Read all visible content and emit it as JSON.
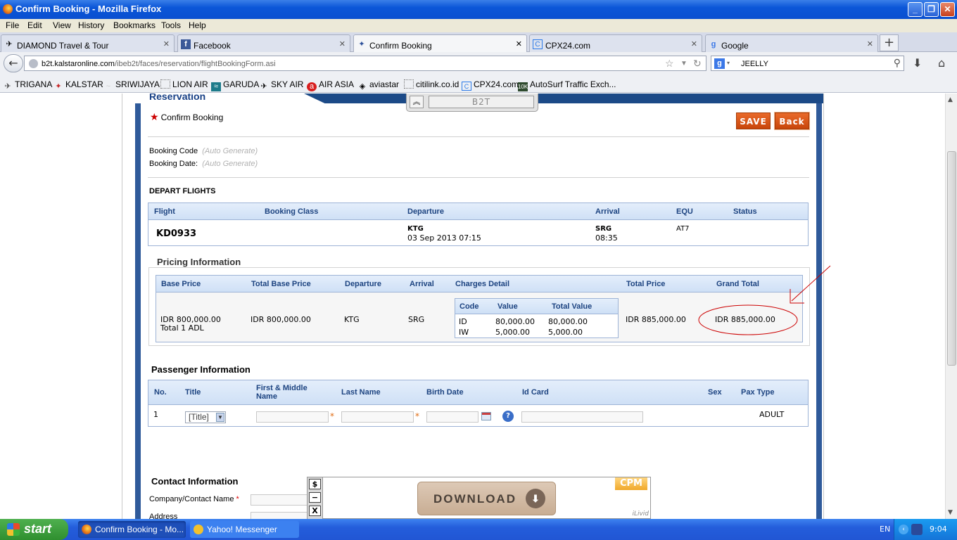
{
  "window": {
    "title": "Confirm Booking - Mozilla Firefox"
  },
  "menu": [
    "File",
    "Edit",
    "View",
    "History",
    "Bookmarks",
    "Tools",
    "Help"
  ],
  "tabs": [
    {
      "label": "DIAMOND Travel & Tour",
      "icon": "airplane-icon"
    },
    {
      "label": "Facebook",
      "icon": "facebook-icon"
    },
    {
      "label": "Confirm Booking",
      "icon": "kalstar-icon"
    },
    {
      "label": "CPX24.com",
      "icon": "cpx-icon"
    },
    {
      "label": "Google",
      "icon": "google-icon"
    }
  ],
  "nav": {
    "url_host": "b2t.kalstaronline.com",
    "url_path": "/ibeb2t/faces/reservation/flightBookingForm.asi",
    "search_value": "JEELLY"
  },
  "bookmarks": [
    "TRIGANA",
    "KALSTAR",
    "SRIWIJAYA",
    "LION AIR",
    "GARUDA",
    "SKY AIR",
    "AIR ASIA",
    "aviastar",
    "citilink.co.id",
    "CPX24.com",
    "AutoSurf Traffic Exch..."
  ],
  "page": {
    "section_title": "Reservation",
    "b2t_label": "B2T",
    "confirm_title": "Confirm Booking",
    "save_label": "SAVE",
    "back_label": "Back",
    "booking_code_label": "Booking Code",
    "booking_code_value": "(Auto Generate)",
    "booking_date_label": "Booking Date:",
    "booking_date_value": "(Auto Generate)",
    "depart_title": "DEPART FLIGHTS",
    "flight_headers": [
      "Flight",
      "Booking Class",
      "Departure",
      "Arrival",
      "EQU",
      "Status"
    ],
    "flight": {
      "number": "KD0933",
      "dep_code": "KTG",
      "dep_time": "03 Sep 2013 07:15",
      "arr_code": "SRG",
      "arr_time": "08:35",
      "equ": "AT7"
    },
    "pricing_title": "Pricing Information",
    "pricing_headers": [
      "Base Price",
      "Total Base Price",
      "Departure",
      "Arrival",
      "Charges Detail",
      "Total Price",
      "Grand Total"
    ],
    "pricing": {
      "base_price": "IDR 800,000.00",
      "pax_total": "Total 1 ADL",
      "total_base": "IDR 800,000.00",
      "departure": "KTG",
      "arrival": "SRG",
      "total_price": "IDR 885,000.00",
      "grand_total": "IDR 885,000.00"
    },
    "charges_headers": [
      "Code",
      "Value",
      "Total Value"
    ],
    "charges": [
      {
        "code": "ID",
        "value": "80,000.00",
        "total": "80,000.00"
      },
      {
        "code": "IW",
        "value": "5,000.00",
        "total": "5,000.00"
      }
    ],
    "passenger_title": "Passenger Information",
    "passenger_headers": [
      "No.",
      "Title",
      "First & Middle Name",
      "Last Name",
      "Birth Date",
      "Id Card",
      "Sex",
      "Pax Type"
    ],
    "passenger": {
      "no": "1",
      "title_select": "[Title]",
      "pax_type": "ADULT"
    },
    "contact_title": "Contact Information",
    "company_label": "Company/Contact Name",
    "address_label": "Address"
  },
  "ad": {
    "download_label": "DOWNLOAD",
    "cpm": "CPM",
    "brand": "iLivid",
    "btn_dollar": "$",
    "btn_min": "−",
    "btn_close": "X"
  },
  "taskbar": {
    "start": "start",
    "items": [
      "Confirm Booking - Mo...",
      "Yahoo! Messenger"
    ],
    "lang": "EN",
    "clock": "9:04"
  },
  "colors": {
    "accent_orange": "#d3531a",
    "header_blue": "#1c4380",
    "annotation_red": "#cc0000"
  }
}
